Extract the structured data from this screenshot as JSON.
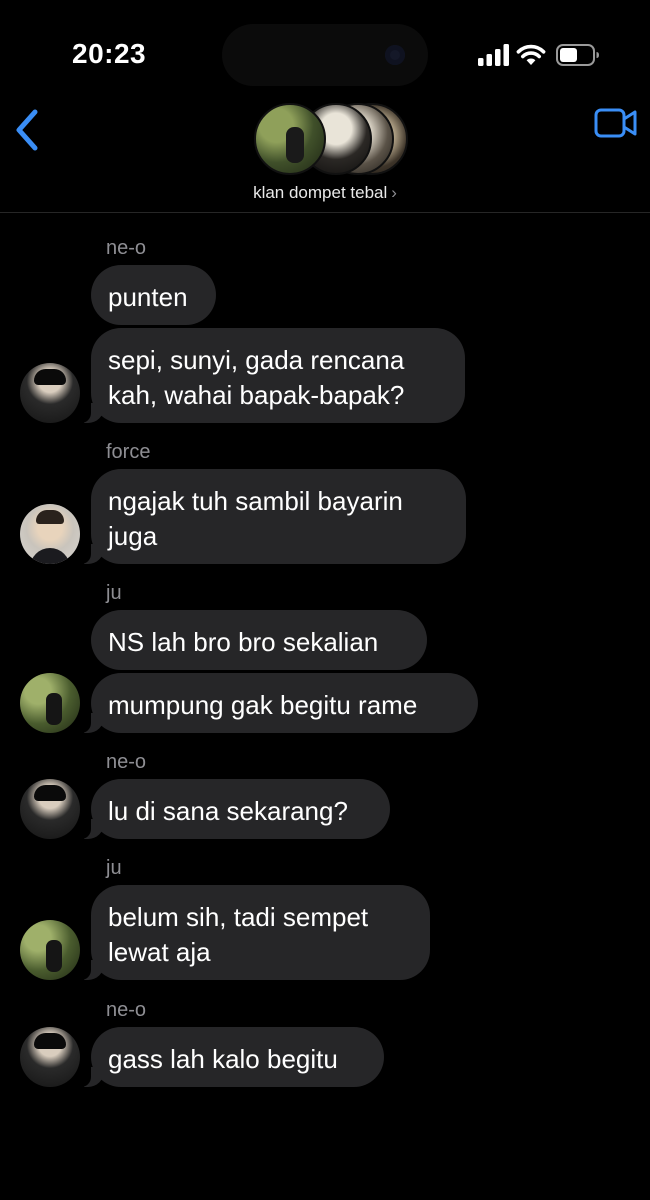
{
  "status_bar": {
    "time": "20:23"
  },
  "header": {
    "back_icon": "chevron-left-icon",
    "video_icon": "video-camera-icon",
    "group_name": "klan dompet tebal",
    "chevron": "›",
    "accent": "#3a8ef6"
  },
  "messages": [
    {
      "sender": "ne-o",
      "text": "punten"
    },
    {
      "text": "sepi, sunyi, gada rencana",
      "text2": "kah, wahai bapak-bapak?"
    },
    {
      "sender": "force",
      "text": "ngajak tuh sambil bayarin",
      "text2": "juga"
    },
    {
      "sender": "ju",
      "text": "NS lah bro bro sekalian"
    },
    {
      "text": "mumpung gak begitu rame"
    },
    {
      "sender": "ne-o",
      "text": "lu di sana sekarang?"
    },
    {
      "sender": "ju",
      "text": "belum sih, tadi sempet",
      "text2": "lewat aja"
    },
    {
      "sender": "ne-o",
      "text": "gass lah kalo begitu"
    }
  ],
  "colors": {
    "bubble": "#262628",
    "sender": "#8e8e93",
    "background": "#000000"
  }
}
